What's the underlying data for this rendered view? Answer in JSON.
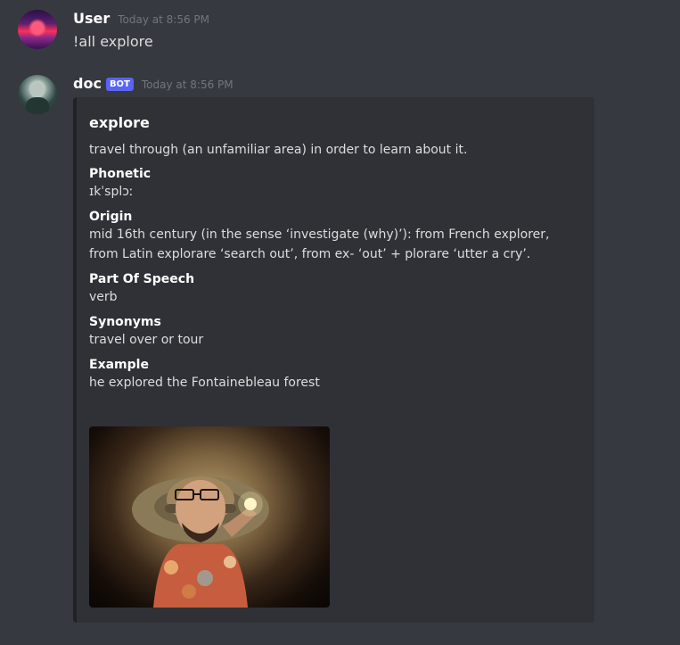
{
  "messages": [
    {
      "author": "User",
      "timestamp": "Today at 8:56 PM",
      "text": "!all explore"
    },
    {
      "author": "doc",
      "badge": "BOT",
      "timestamp": "Today at 8:56 PM",
      "embed": {
        "title": "explore",
        "description": "travel through (an unfamiliar area) in order to learn about it.",
        "fields": [
          {
            "name": "Phonetic",
            "value": "ɪkˈsplɔː"
          },
          {
            "name": "Origin",
            "value": "mid 16th century (in the sense ‘investigate (why)’): from French explorer, from Latin explorare ‘search out’, from ex- ‘out’ + plorare ‘utter a cry’."
          },
          {
            "name": "Part Of Speech",
            "value": "verb"
          },
          {
            "name": "Synonyms",
            "value": "travel over or tour"
          },
          {
            "name": "Example",
            "value": "he explored the Fontainebleau forest"
          }
        ]
      }
    }
  ],
  "colors": {
    "background": "#36393f",
    "embed_background": "#2f3136",
    "embed_border": "#202225",
    "badge": "#5865f2",
    "timestamp": "#72767d"
  },
  "icons": {
    "user_avatar": "user-avatar-image",
    "bot_avatar": "bot-avatar-image",
    "embed_image": "explorer-photo"
  }
}
